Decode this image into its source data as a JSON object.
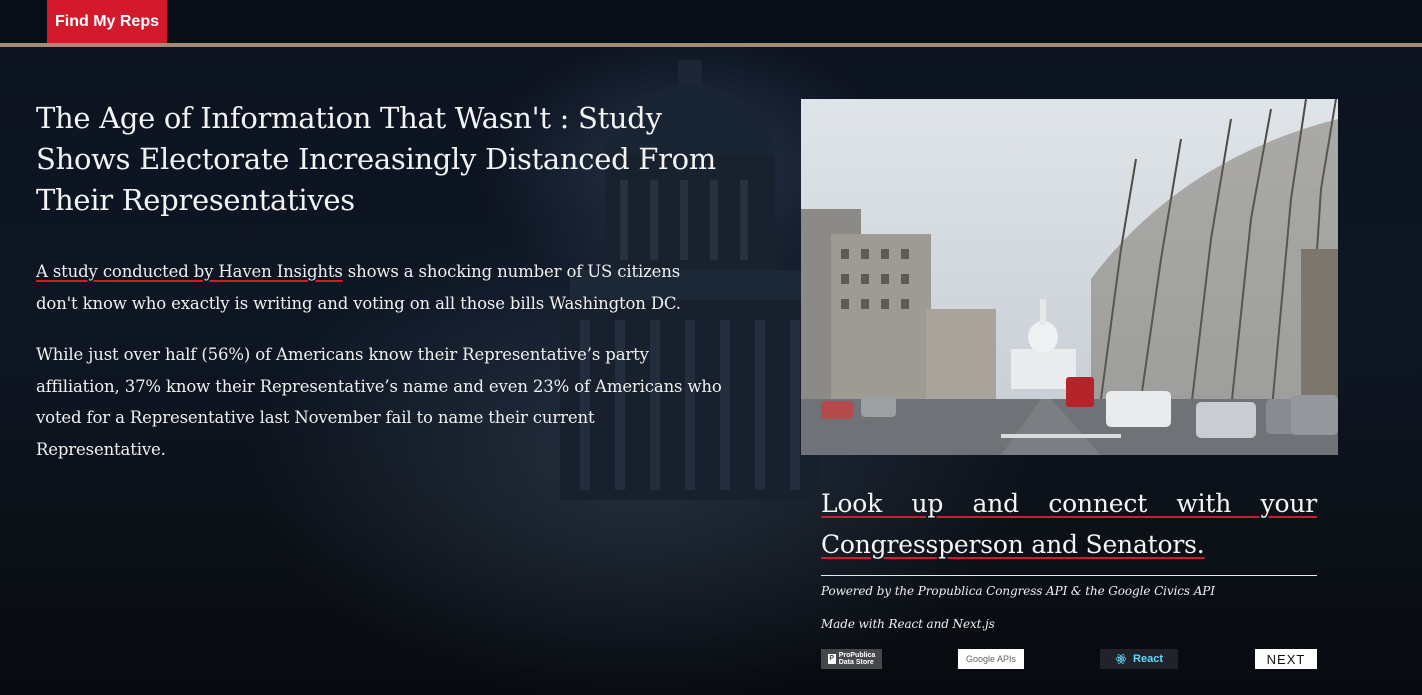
{
  "nav": {
    "find_reps_label": "Find My Reps"
  },
  "article": {
    "headline": "The Age of Information That Wasn't : Study Shows Electorate Increasingly Distanced From Their Representatives",
    "paragraph1": {
      "link_text": "A study conducted by Haven Insights",
      "rest": " shows a shocking number of US citizens don't know who exactly is writing and voting on all those bills Washington DC."
    },
    "paragraph2": "While just over half (56%) of Americans know their Representative’s party affiliation, 37% know their Representative’s name and even 23% of Americans who voted for a Representative last November fail to name their current Representative."
  },
  "cta": {
    "text": "Look up and connect with your Congressperson and Senators."
  },
  "credits": {
    "powered_by": "Powered by the Propublica Congress API & the Google Civics API",
    "made_with": "Made with React and Next.js"
  },
  "logos": {
    "propublica_mark": "P",
    "propublica_line1": "ProPublica",
    "propublica_line2": "Data Store",
    "google": "Google APIs",
    "react": "React",
    "next": "NEXT"
  },
  "colors": {
    "accent_red": "#d21a2c",
    "divider_tan": "#a28c78",
    "background": "#0b0f19",
    "react_cyan": "#61dafb"
  },
  "icons": {
    "react_logo": "react-atom-icon"
  }
}
